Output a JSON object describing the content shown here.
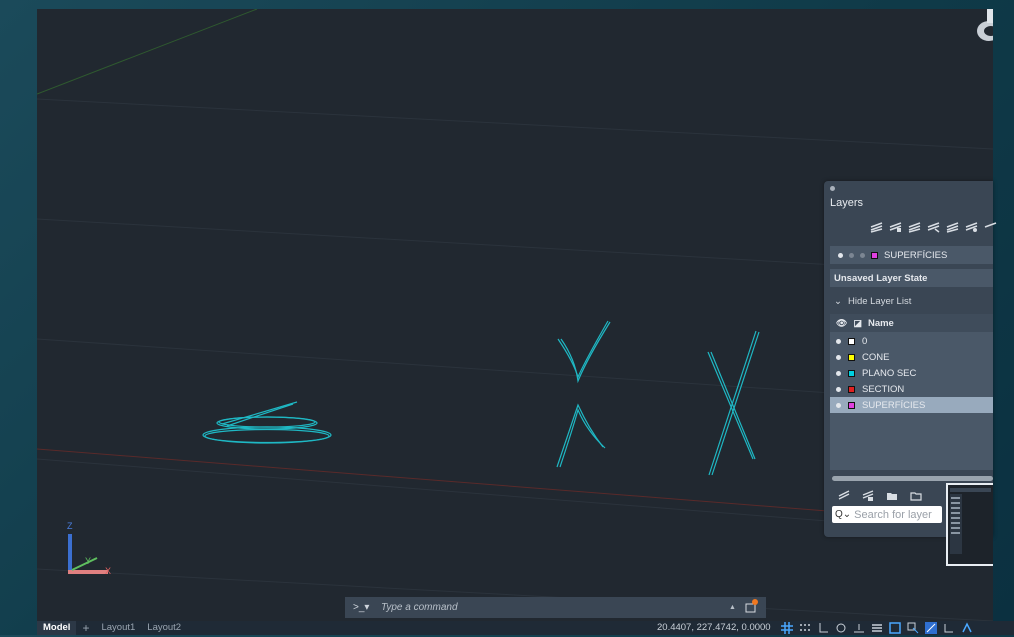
{
  "layers_panel": {
    "title": "Layers",
    "current_layer": "SUPERFÍCIES",
    "layer_state": "Unsaved Layer State",
    "hide_list_label": "Hide Layer List",
    "column_name": "Name",
    "layers": [
      {
        "name": "0",
        "color": "#ffffff"
      },
      {
        "name": "CONE",
        "color": "#ffff00"
      },
      {
        "name": "PLANO SEC",
        "color": "#00d0e0"
      },
      {
        "name": "SECTION",
        "color": "#e02020"
      },
      {
        "name": "SUPERFÍCIES",
        "color": "#e040e0",
        "selected": true
      }
    ],
    "search_placeholder": "Search for layer"
  },
  "command_line": {
    "prompt": ">_▾",
    "placeholder": "Type a command"
  },
  "status_bar": {
    "tabs": [
      "Model",
      "Layout1",
      "Layout2"
    ],
    "add_tab": "+",
    "coordinates": "20.4407, 227.4742, 0.0000"
  },
  "ucs": {
    "x": "X",
    "y": "Y",
    "z": "Z"
  },
  "colors": {
    "accent": "#1fb8c4",
    "canvas": "#212830"
  }
}
